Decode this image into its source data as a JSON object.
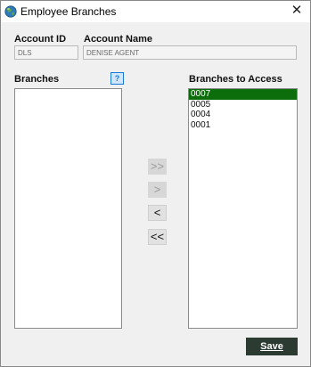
{
  "window": {
    "title": "Employee Branches",
    "close_glyph": "✕"
  },
  "account": {
    "id_label": "Account ID",
    "id_value": "DLS",
    "name_label": "Account Name",
    "name_value": "DENISE AGENT"
  },
  "branches": {
    "label": "Branches",
    "help_glyph": "?",
    "items": []
  },
  "access": {
    "label": "Branches to Access",
    "items": [
      "0007",
      "0005",
      "0004",
      "0001"
    ],
    "selected_index": 0
  },
  "move_buttons": [
    {
      "label": ">>",
      "name": "move-all-right-button",
      "enabled": false
    },
    {
      "label": ">",
      "name": "move-right-button",
      "enabled": false
    },
    {
      "label": "<",
      "name": "move-left-button",
      "enabled": true
    },
    {
      "label": "<<",
      "name": "move-all-left-button",
      "enabled": true
    }
  ],
  "save_label": "Save"
}
